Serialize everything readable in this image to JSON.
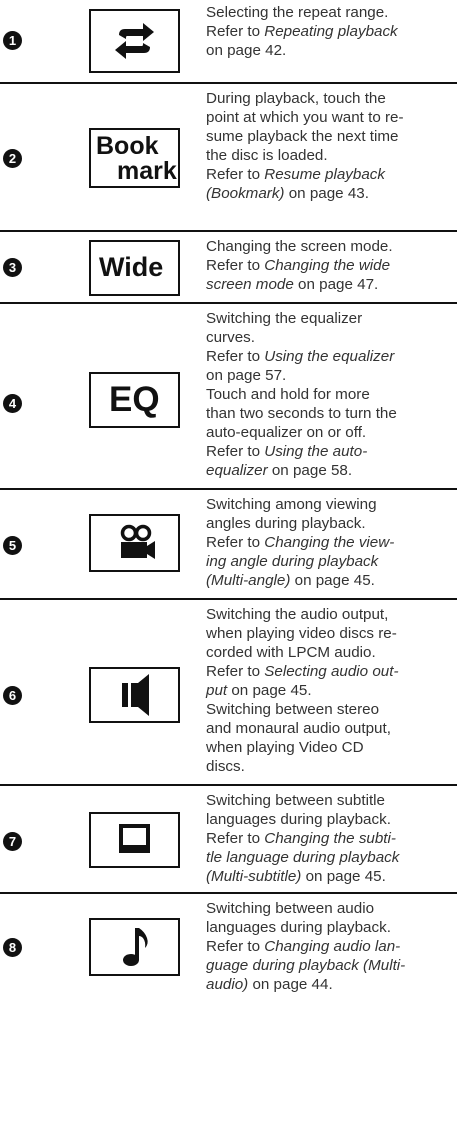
{
  "rows": [
    {
      "number": "1",
      "button": {
        "label": "",
        "icon": "repeat-icon"
      },
      "lines": [
        {
          "text": "Selecting the repeat range."
        },
        {
          "pre": "Refer to ",
          "ital": "Repeating playback",
          "post": ""
        },
        {
          "pre": "",
          "ital": "",
          "post": "on page 42."
        }
      ]
    },
    {
      "number": "2",
      "button": {
        "label_line1": "Book",
        "label_line2": "mark",
        "icon": "bookmark-text"
      },
      "lines": [
        {
          "text": "During playback, touch the"
        },
        {
          "text": "point at which you want to re-"
        },
        {
          "text": "sume playback the next time"
        },
        {
          "text": "the disc is loaded."
        },
        {
          "pre": "Refer to ",
          "ital": "Resume playback",
          "post": ""
        },
        {
          "pre": "",
          "ital": "(Bookmark)",
          "post": " on page 43."
        }
      ]
    },
    {
      "number": "3",
      "button": {
        "label": "Wide",
        "icon": "wide-text"
      },
      "lines": [
        {
          "text": "Changing the screen mode."
        },
        {
          "pre": "Refer to ",
          "ital": "Changing the wide",
          "post": ""
        },
        {
          "pre": "",
          "ital": "screen mode",
          "post": " on page 47."
        }
      ]
    },
    {
      "number": "4",
      "button": {
        "label": "EQ",
        "icon": "eq-text"
      },
      "lines": [
        {
          "text": "Switching the equalizer"
        },
        {
          "text": "curves."
        },
        {
          "pre": "Refer to ",
          "ital": "Using the equalizer",
          "post": ""
        },
        {
          "pre": "",
          "ital": "",
          "post": "on page 57."
        },
        {
          "text": "Touch and hold for more"
        },
        {
          "text": "than two seconds to turn the"
        },
        {
          "text": "auto-equalizer on or off."
        },
        {
          "pre": "Refer to ",
          "ital": "Using the auto-",
          "post": ""
        },
        {
          "pre": "",
          "ital": "equalizer",
          "post": " on page 58."
        }
      ]
    },
    {
      "number": "5",
      "button": {
        "label": "",
        "icon": "camera-angle-icon"
      },
      "lines": [
        {
          "text": "Switching among viewing"
        },
        {
          "text": "angles during playback."
        },
        {
          "pre": "Refer to ",
          "ital": "Changing the view-",
          "post": ""
        },
        {
          "pre": "",
          "ital": "ing angle during playback",
          "post": ""
        },
        {
          "pre": "",
          "ital": "(Multi-angle)",
          "post": " on page 45."
        }
      ]
    },
    {
      "number": "6",
      "button": {
        "label": "",
        "icon": "speaker-icon"
      },
      "lines": [
        {
          "text": "Switching the audio output,"
        },
        {
          "text": "when playing video discs re-"
        },
        {
          "text": "corded with LPCM audio."
        },
        {
          "pre": "Refer to ",
          "ital": "Selecting audio out-",
          "post": ""
        },
        {
          "pre": "",
          "ital": "put",
          "post": " on page 45."
        },
        {
          "text": "Switching between stereo"
        },
        {
          "text": "and monaural audio output,"
        },
        {
          "text": "when playing Video CD"
        },
        {
          "text": "discs."
        }
      ]
    },
    {
      "number": "7",
      "button": {
        "label": "",
        "icon": "subtitle-icon"
      },
      "lines": [
        {
          "text": "Switching between subtitle"
        },
        {
          "text": "languages during playback."
        },
        {
          "pre": "Refer to ",
          "ital": "Changing the subti-",
          "post": ""
        },
        {
          "pre": "",
          "ital": "tle language during playback",
          "post": ""
        },
        {
          "pre": "",
          "ital": "(Multi-subtitle)",
          "post": " on page 45."
        }
      ]
    },
    {
      "number": "8",
      "button": {
        "label": "",
        "icon": "music-note-icon"
      },
      "lines": [
        {
          "text": "Switching between audio"
        },
        {
          "text": "languages during playback."
        },
        {
          "pre": "Refer to ",
          "ital": "Changing audio lan-",
          "post": ""
        },
        {
          "pre": "",
          "ital": "guage during playback (Multi-",
          "post": ""
        },
        {
          "pre": "",
          "ital": "audio)",
          "post": " on page 44."
        }
      ]
    }
  ]
}
